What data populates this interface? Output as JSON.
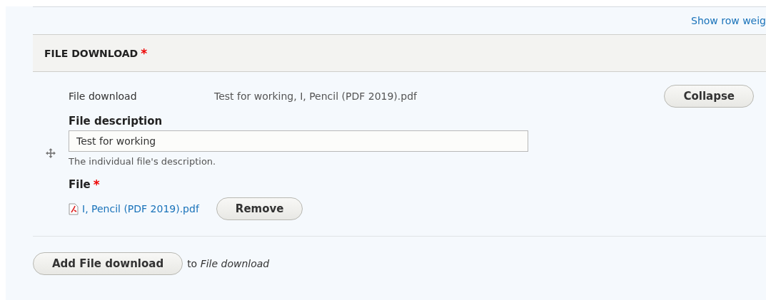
{
  "table_link": "Show row weig",
  "section": {
    "title": "FILE DOWNLOAD",
    "required_mark": "*"
  },
  "item": {
    "label": "File download",
    "summary": "Test for working, I, Pencil (PDF 2019).pdf",
    "toggle_button": "Collapse",
    "description_field": {
      "label": "File description",
      "value": "Test for working",
      "help": "The individual file's description."
    },
    "file_field": {
      "label": "File",
      "required_mark": "*",
      "file_name": "I, Pencil (PDF 2019).pdf",
      "remove_button": "Remove"
    }
  },
  "add_button": "Add File download",
  "add_target": "to *File download*"
}
